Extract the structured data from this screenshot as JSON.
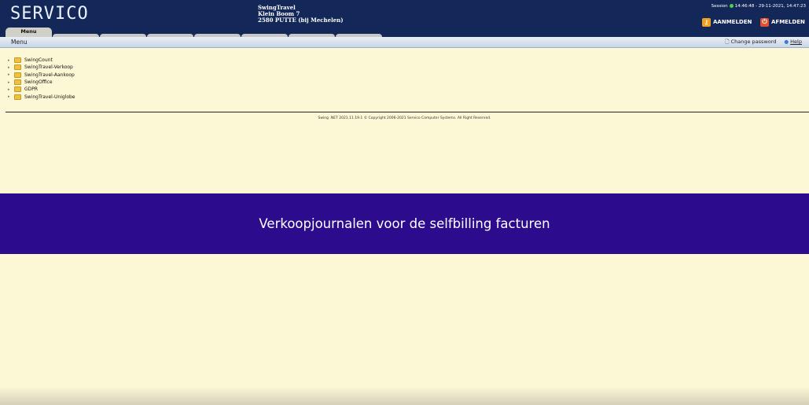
{
  "header": {
    "logo": "SERVICO",
    "company": "SwingTravel",
    "address_line1": "Klein Boom 7",
    "address_line2": "2580 PUTTE (bij Mechelen)",
    "session_label": "Session",
    "session_time": "14:46:48 - 29-11-2021, 14:47:23",
    "login_label": "AANMELDEN",
    "logout_label": "AFMELDEN"
  },
  "tabs": [
    {
      "label": "Menu"
    },
    {
      "label": ""
    },
    {
      "label": ""
    },
    {
      "label": ""
    },
    {
      "label": ""
    },
    {
      "label": ""
    },
    {
      "label": ""
    },
    {
      "label": ""
    }
  ],
  "menubar": {
    "title": "Menu",
    "change_password": "Change password",
    "help": "Help"
  },
  "tree": [
    {
      "label": "SwingCount"
    },
    {
      "label": "SwingTravel-Verkoop"
    },
    {
      "label": "SwingTravel-Aankoop"
    },
    {
      "label": "SwingOffice"
    },
    {
      "label": "GDPR"
    },
    {
      "label": "SwingTravel-Uniglobe"
    }
  ],
  "footer": "Swing .NET 2021.11.19.1 © Copyright 2006-2021 Servico Computer Systems. All Right Reserved.",
  "banner": "Verkoopjournalen voor de selfbilling facturen"
}
